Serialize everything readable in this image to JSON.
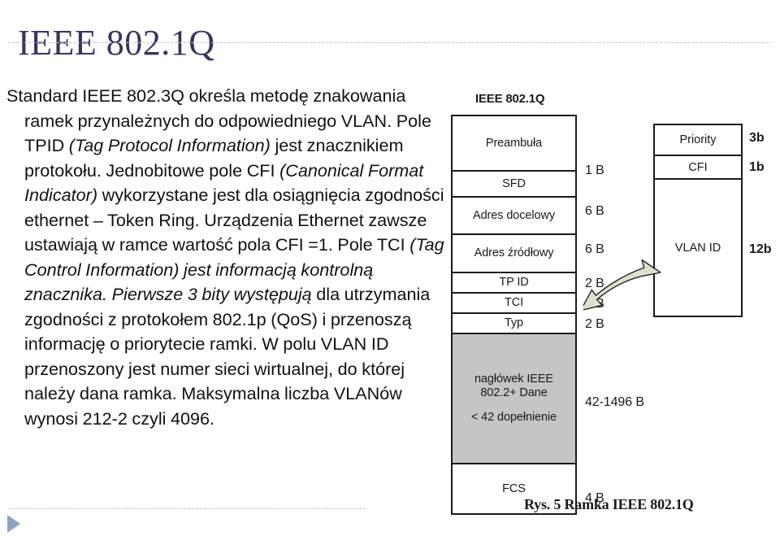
{
  "slide": {
    "title": "IEEE 802.1Q",
    "title_color": "#33375a",
    "rule_color": "#c2c2cc",
    "nav_triangle_color": "#8da4c0"
  },
  "body": {
    "paragraph_html": "Standard IEEE 802.3Q określa metodę znakowania ramek przynależnych do odpowiedniego VLAN. Pole TPID <i>(Tag Protocol Information)</i> jest znacznikiem protokołu. Jednobitowe pole CFI <i>(Canonical Format Indicator)</i> wykorzystane jest dla osiągnięcia zgodności ethernet – Token Ring. Urządzenia Ethernet zawsze ustawiają w ramce wartość pola CFI =1. Pole TCI <i>(Tag Control Information) jest informacją kontrolną znacznika. Pierwsze 3 bity występują</i> dla utrzymania zgodności z protokołem 802.1p (QoS) i przenoszą informację o priorytecie ramki. W polu VLAN ID przenoszony jest numer sieci wirtualnej, do której należy dana ramka. Maksymalna liczba VLANów wynosi 212-2 czyli 4096."
  },
  "figure": {
    "heading": "IEEE 802.1Q",
    "caption": "Rys. 5 Ramka IEEE 802.1Q",
    "shaded_fill": "#c5c5c1",
    "arrow_fill": "#dde2cf",
    "frame_rows": [
      {
        "label": "Preambuła",
        "size": "",
        "shaded": false
      },
      {
        "label": "SFD",
        "size": "1 B",
        "shaded": false
      },
      {
        "label": "Adres docelowy",
        "size": "6 B",
        "shaded": false
      },
      {
        "label": "Adres źródłowy",
        "size": "6 B",
        "shaded": false
      },
      {
        "label": "TP ID",
        "size": "2 B",
        "shaded": false
      },
      {
        "label": "TCI",
        "size": "2 B",
        "shaded": false
      },
      {
        "label": "Typ",
        "size": "2 B",
        "shaded": false
      },
      {
        "label_line1": "nagłówek IEEE",
        "label_line2": "802.2+ Dane",
        "label_line3": "< 42 dopełnienie",
        "size": "42-1496 B",
        "shaded": true
      },
      {
        "label": "FCS",
        "size": "4 B",
        "shaded": false
      }
    ],
    "tci_rows": [
      {
        "label": "Priority",
        "size": "3b"
      },
      {
        "label": "CFI",
        "size": "1b"
      },
      {
        "label": "VLAN ID",
        "size": "12b"
      }
    ]
  }
}
